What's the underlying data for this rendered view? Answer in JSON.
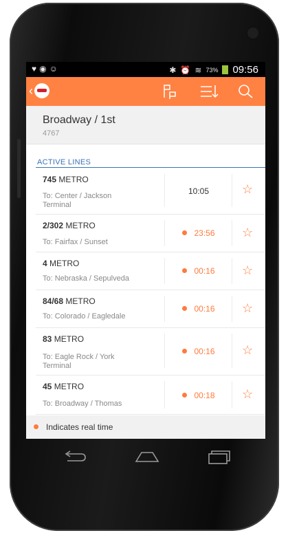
{
  "status_bar": {
    "clock": "09:56",
    "battery_percent": "73%"
  },
  "stop": {
    "name": "Broadway / 1st",
    "code": "4767"
  },
  "section_title": "ACTIVE LINES",
  "rows": [
    {
      "route": "745",
      "agency": "METRO",
      "dest_line1": "To: Center / Jackson",
      "dest_line2": "Terminal",
      "time": "10:05",
      "realtime": false
    },
    {
      "route": "2/302",
      "agency": "METRO",
      "dest_line1": "To: Fairfax / Sunset",
      "dest_line2": "",
      "time": "23:56",
      "realtime": true
    },
    {
      "route": "4",
      "agency": "METRO",
      "dest_line1": "To: Nebraska / Sepulveda",
      "dest_line2": "",
      "time": "00:16",
      "realtime": true
    },
    {
      "route": "84/68",
      "agency": "METRO",
      "dest_line1": "To: Colorado / Eagledale",
      "dest_line2": "",
      "time": "00:16",
      "realtime": true
    },
    {
      "route": "83",
      "agency": "METRO",
      "dest_line1": "To: Eagle Rock / York",
      "dest_line2": "Terminal",
      "time": "00:16",
      "realtime": true
    },
    {
      "route": "45",
      "agency": "METRO",
      "dest_line1": "To: Broadway / Thomas",
      "dest_line2": "",
      "time": "00:18",
      "realtime": true
    }
  ],
  "legend": "Indicates real time",
  "colors": {
    "accent": "#ff8243",
    "section": "#3a72b4",
    "realtime": "#ff7a3d"
  }
}
